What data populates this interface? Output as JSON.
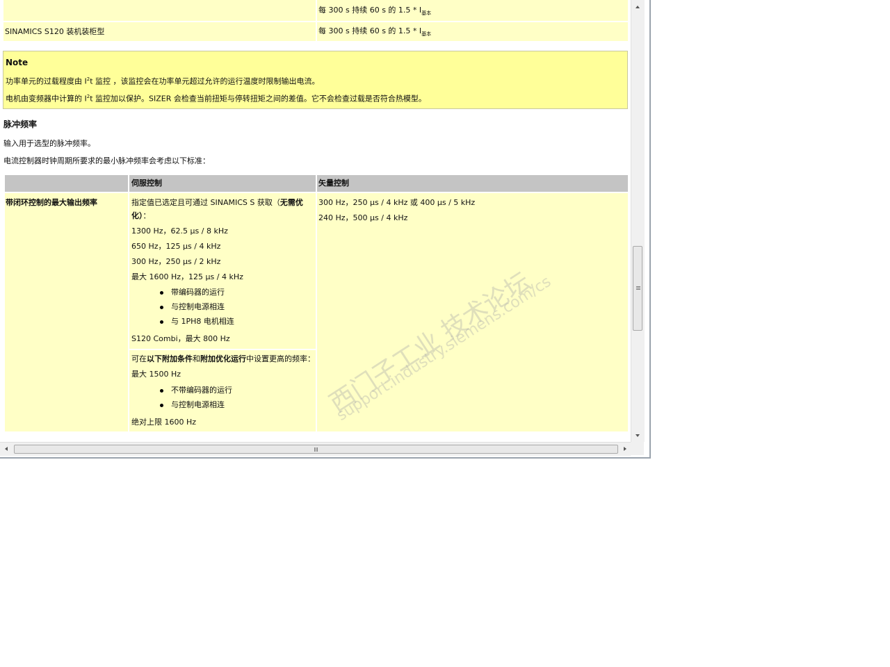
{
  "top_table": {
    "row1_value_prefix": "每 300 s 持续 60 s 的 1.5 * I",
    "row1_value_sub": "基本",
    "row2_label": "SINAMICS S120 装机装柜型",
    "row2_value_prefix": "每 300 s 持续 60 s 的 1.5 * I",
    "row2_value_sub": "基本"
  },
  "note": {
    "title": "Note",
    "line1_a": "功率单元的过载程度由 I",
    "line1_sup": "2",
    "line1_b": "t 监控 ，该监控会在功率单元超过允许的运行温度时限制输出电流。",
    "line2_a": "电机由变频器中计算的 I",
    "line2_sup": "2",
    "line2_b": "t 监控加以保护。SIZER 会检查当前扭矩与停转扭矩之间的差值。它不会检查过载是否符合热模型。"
  },
  "section": {
    "heading": "脉冲频率",
    "para1": "输入用于选型的脉冲频率。",
    "para2": "电流控制器时钟周期所要求的最小脉冲频率会考虑以下标准："
  },
  "freq_table": {
    "headers": [
      "",
      "伺服控制",
      "矢量控制"
    ],
    "row_label": "带闭环控制的最大输出频率",
    "servo_intro_a": "指定值已选定且可通过 SINAMICS S 获取（",
    "servo_intro_bold": "无需优",
    "servo_intro_line2_bold": "化）",
    "servo_intro_line2_rest": "：",
    "servo_values": [
      "1300 Hz，62.5 µs / 8 kHz",
      "650 Hz，125 µs / 4 kHz",
      "300 Hz，250 µs / 2 kHz",
      "最大 1600 Hz，125 µs / 4 kHz"
    ],
    "servo_bullets": [
      "带编码器的运行",
      "与控制电源相连",
      "与 1PH8 电机相连"
    ],
    "servo_combi": "S120 Combi，最大 800 Hz",
    "opt_a": "可在",
    "opt_bold1": "以下附加条件",
    "opt_b": "和",
    "opt_bold2": "附加优化运行",
    "opt_c": "中设置更高的频率：",
    "opt_max": "最大 1500 Hz",
    "opt_bullets": [
      "不带编码器的运行",
      "与控制电源相连"
    ],
    "opt_limit": "绝对上限 1600 Hz",
    "vector_values": [
      "300 Hz，250 µs / 4 kHz 或 400 µs / 5 kHz",
      "240 Hz，500 µs / 4 kHz"
    ]
  },
  "watermark": {
    "line1": "西门子工业  技术论坛",
    "line2": "support.industry.siemens.com/cs"
  },
  "colors": {
    "cell_bg": "#ffffc6",
    "note_bg": "#ffff99",
    "header_bg": "#c4c4c4"
  }
}
